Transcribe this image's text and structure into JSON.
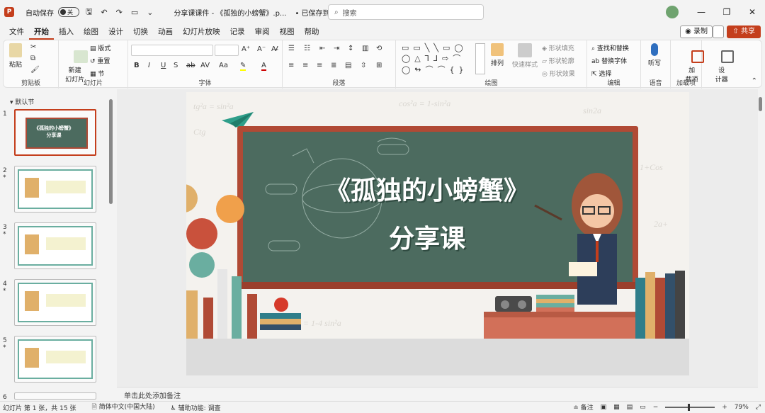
{
  "titlebar": {
    "autosave_label": "自动保存",
    "autosave_state": "关",
    "doc_title": "分享课课件 - 《孤独的小螃蟹》.p...",
    "save_status": "• 已保存到这台电脑",
    "search_placeholder": "搜索"
  },
  "tabs": [
    "文件",
    "开始",
    "插入",
    "绘图",
    "设计",
    "切换",
    "动画",
    "幻灯片放映",
    "记录",
    "审阅",
    "视图",
    "帮助"
  ],
  "tab_actions": {
    "record": "录制",
    "share": "共享"
  },
  "ribbon": {
    "groups": [
      "剪贴板",
      "幻灯片",
      "字体",
      "段落",
      "绘图",
      "编辑",
      "语音",
      "加载项"
    ],
    "paste": "粘贴",
    "new_slide": "新建\n幻灯片",
    "layout": "版式",
    "reset": "重置",
    "section": "节",
    "arrange": "排列",
    "quick_styles": "快速样式",
    "shape_fill": "形状填充",
    "shape_outline": "形状轮廓",
    "shape_effects": "形状效果",
    "find_replace": "查找和替换",
    "replace_font": "替换字体",
    "select": "选择",
    "dictate": "听写",
    "addins": "加\n载项",
    "designer": "设\n计器"
  },
  "panel": {
    "section_label": "默认节",
    "slides": [
      {
        "num": "1",
        "star": ""
      },
      {
        "num": "2",
        "star": "*"
      },
      {
        "num": "3",
        "star": "*"
      },
      {
        "num": "4",
        "star": "*"
      },
      {
        "num": "5",
        "star": "*"
      },
      {
        "num": "6",
        "star": ""
      }
    ]
  },
  "slide": {
    "title": "《孤独的小螃蟹》",
    "subtitle": "分享课"
  },
  "notes_placeholder": "单击此处添加备注",
  "status": {
    "slide_info": "幻灯片 第 1 张，共 15 张",
    "language": "简体中文(中国大陆)",
    "accessibility": "辅助功能: 调查",
    "notes": "备注",
    "zoom": "79%"
  },
  "colors": {
    "accent": "#c43e1c",
    "board": "#4c6b5f",
    "board_frame": "#b04a35"
  }
}
